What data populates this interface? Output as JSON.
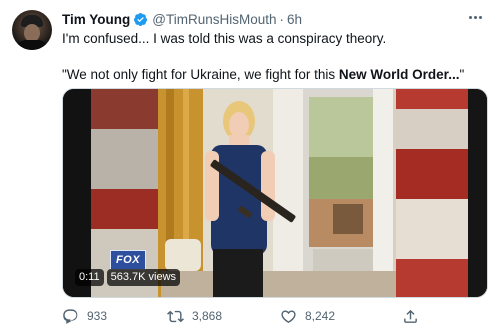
{
  "author": {
    "name": "Tim Young",
    "handle": "@TimRunsHisMouth",
    "separator": "·",
    "time": "6h",
    "verified": true
  },
  "tweet": {
    "line1": "I'm confused... I was told this was a conspiracy theory.",
    "quote_open": "\"We not only fight for Ukraine, we fight for this ",
    "quote_bold": "New World Order...",
    "quote_close": "\""
  },
  "media": {
    "type": "video",
    "network_logo": "FOX",
    "duration": "0:11",
    "views": "563.7K views"
  },
  "actions": {
    "replies": "933",
    "retweets": "3,868",
    "likes": "8,242"
  },
  "icons": {
    "verified": "verified-badge-icon",
    "more": "more-options-icon",
    "reply": "reply-icon",
    "retweet": "retweet-icon",
    "like": "heart-icon",
    "share": "share-icon"
  },
  "colors": {
    "verified_blue": "#1d9bf0",
    "secondary_text": "#536471",
    "primary_text": "#0f1419"
  }
}
